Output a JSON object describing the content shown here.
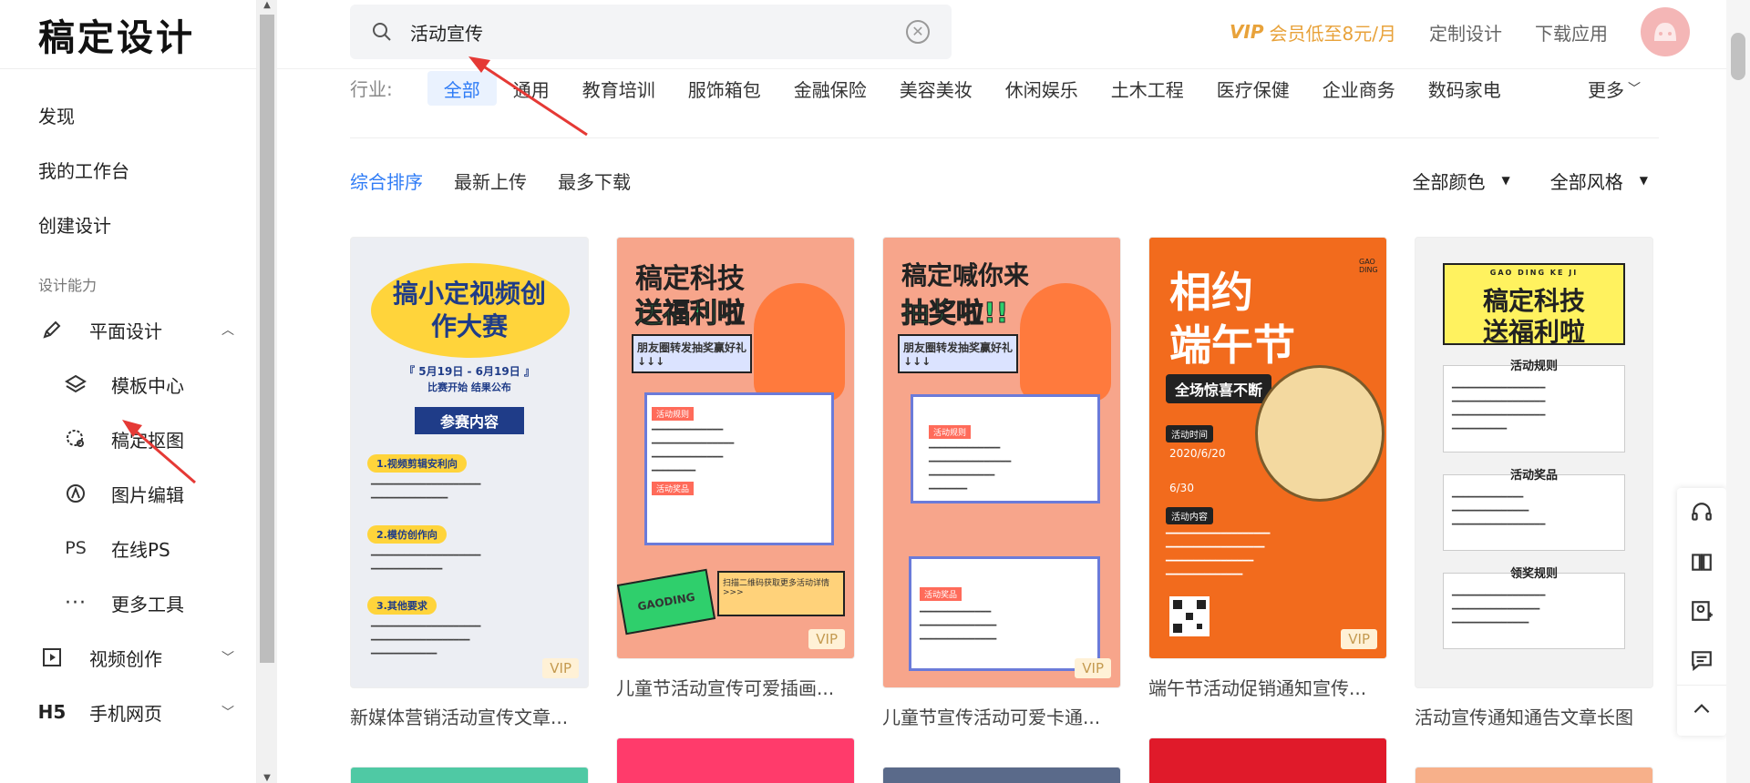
{
  "sidebar": {
    "logo": "稿定设计",
    "nav": [
      "发现",
      "我的工作台",
      "创建设计"
    ],
    "section_label": "设计能力",
    "groups": {
      "graphic": "平面设计",
      "video": "视频创作",
      "h5": "手机网页"
    },
    "sub_items": [
      "模板中心",
      "稿定抠图",
      "图片编辑",
      "在线PS",
      "更多工具"
    ],
    "h5_icon_text": "H5",
    "ps_icon_text": "PS"
  },
  "search": {
    "value": "活动宣传"
  },
  "header": {
    "vip_icon": "VIP",
    "vip_text": "会员低至8元/月",
    "custom": "定制设计",
    "download": "下载应用"
  },
  "industry": {
    "label": "行业:",
    "tags": [
      "全部",
      "通用",
      "教育培训",
      "服饰箱包",
      "金融保险",
      "美容美妆",
      "休闲娱乐",
      "土木工程",
      "医疗保健",
      "企业商务",
      "数码家电"
    ],
    "more": "更多"
  },
  "sort": {
    "options": [
      "综合排序",
      "最新上传",
      "最多下载"
    ],
    "filters": [
      "全部颜色",
      "全部风格"
    ]
  },
  "cards": [
    {
      "title": "新媒体营销活动宣传文章...",
      "vip": "VIP",
      "heading": "搞小定视频创作大赛",
      "sub": "『 5月19日 - 6月19日 』",
      "sub2": "比赛开始 结果公布",
      "btn": "参赛内容",
      "s1": "1.视频剪辑安利向",
      "s2": "2.模仿创作向",
      "s3": "3.其他要求"
    },
    {
      "title": "儿童节活动宣传可爱插画...",
      "vip": "VIP",
      "heading": "稿定科技",
      "heading2": "送福利啦",
      "note": "朋友圈转发抽奖赢好礼↓↓↓",
      "rules": "活动规则",
      "prize": "活动奖品",
      "brand": "GAODING",
      "qr": "扫描二维码获取更多活动详情 >>>"
    },
    {
      "title": "儿童节宣传活动可爱卡通...",
      "vip": "VIP",
      "heading": "稿定喊你来",
      "heading2": "抽奖啦!!",
      "note": "朋友圈转发抽奖赢好礼↓↓↓",
      "rules": "活动规则",
      "prize": "活动奖品"
    },
    {
      "title": "端午节活动促销通知宣传...",
      "vip": "VIP",
      "heading": "相约",
      "heading2": "端午节",
      "banner": "全场惊喜不断",
      "time_label": "活动时间",
      "content_label": "活动内容",
      "brand": "GAO DING",
      "date": "2020/6/20",
      "to": "6/30"
    },
    {
      "title": "活动宣传通知通告文章长图",
      "top": "GAO DING KE JI",
      "heading": "稿定科技",
      "heading2": "送福利啦",
      "s1": "活动规则",
      "s2": "活动奖品",
      "s3": "领奖规则"
    }
  ],
  "floatbar": {
    "icons": [
      "headset-icon",
      "book-icon",
      "contact-icon",
      "message-icon",
      "back-to-top-icon"
    ]
  }
}
